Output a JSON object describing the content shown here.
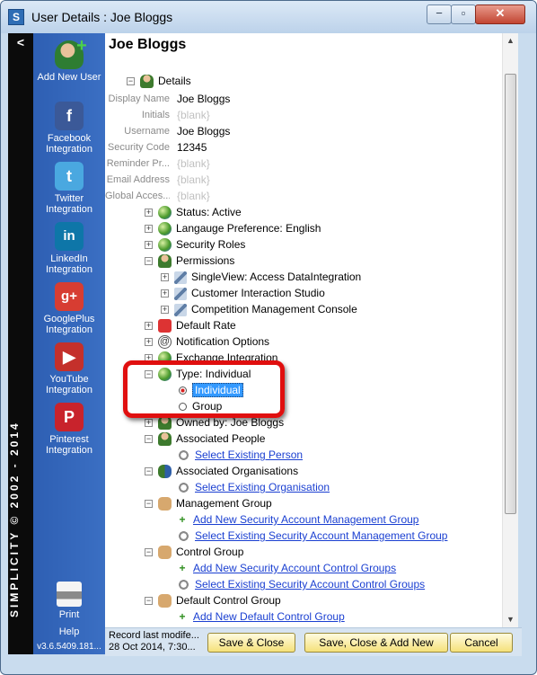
{
  "window": {
    "title": "User Details : Joe Bloggs",
    "minimize": "−",
    "maximize": "▫",
    "close": "✕"
  },
  "brand": {
    "text": "SIMPLICITY © 2002 - 2014",
    "collapse_arrow": "<"
  },
  "sidebar": {
    "items": [
      {
        "label": "Add New User",
        "icon": "add-user-icon"
      },
      {
        "label": "Facebook Integration",
        "icon": "facebook-icon",
        "color": "#3b5998"
      },
      {
        "label": "Twitter Integration",
        "icon": "twitter-icon",
        "color": "#4aa8e0"
      },
      {
        "label": "LinkedIn Integration",
        "icon": "linkedin-icon",
        "color": "#0e76a8"
      },
      {
        "label": "GooglePlus Integration",
        "icon": "googleplus-icon",
        "color": "#d73d32"
      },
      {
        "label": "YouTube Integration",
        "icon": "youtube-icon",
        "color": "#c4302b"
      },
      {
        "label": "Pinterest Integration",
        "icon": "pinterest-icon",
        "color": "#c8232c"
      },
      {
        "label": "Print",
        "icon": "printer-icon"
      }
    ],
    "help": "Help",
    "version": "v3.6.5409.181..."
  },
  "main": {
    "title": "Joe Bloggs",
    "details_label": "Details",
    "fields": [
      {
        "label": "Display Name",
        "value": "Joe Bloggs"
      },
      {
        "label": "Initials",
        "value": "{blank}"
      },
      {
        "label": "Username",
        "value": "Joe Bloggs"
      },
      {
        "label": "Security Code",
        "value": "12345"
      },
      {
        "label": "Reminder Pr...",
        "value": "{blank}"
      },
      {
        "label": "Email Address",
        "value": "{blank}"
      },
      {
        "label": "Global Acces...",
        "value": "{blank}"
      }
    ],
    "status": "Status:  Active",
    "language": "Langauge Preference:  English",
    "security_roles": "Security Roles",
    "permissions": "Permissions",
    "permission_items": [
      "SingleView:  Access DataIntegration",
      "Customer Interaction Studio",
      "Competition Management Console"
    ],
    "default_rate": "Default Rate",
    "notification_options": "Notification Options",
    "exchange_integration": "Exchange Integration",
    "type": "Type:  Individual",
    "type_options": [
      "Individual",
      "Group"
    ],
    "owned_by": "Owned by:  Joe Bloggs",
    "associated_people": "Associated People",
    "select_existing_person": "Select Existing Person",
    "associated_organisations": "Associated Organisations",
    "select_existing_organisation": "Select Existing Organisation",
    "management_group": "Management Group",
    "add_mgmt_group": "Add New Security Account Management Group",
    "select_mgmt_group": "Select Existing Security Account Management Group",
    "control_group": "Control Group",
    "add_control_groups": "Add New Security Account Control Groups",
    "select_control_groups": "Select Existing Security Account Control Groups",
    "default_control_group": "Default Control Group",
    "add_default_control_group": "Add New Default Control Group"
  },
  "footer": {
    "record_line1": "Record last modife...",
    "record_line2": "28 Oct 2014, 7:30...",
    "save_close": "Save & Close",
    "save_close_add": "Save, Close & Add New",
    "cancel": "Cancel"
  },
  "colors": {
    "sidebar": "#3366bb",
    "link": "#1a3fd1",
    "highlight_border": "#e00f0f",
    "button": "#f5e17a"
  }
}
